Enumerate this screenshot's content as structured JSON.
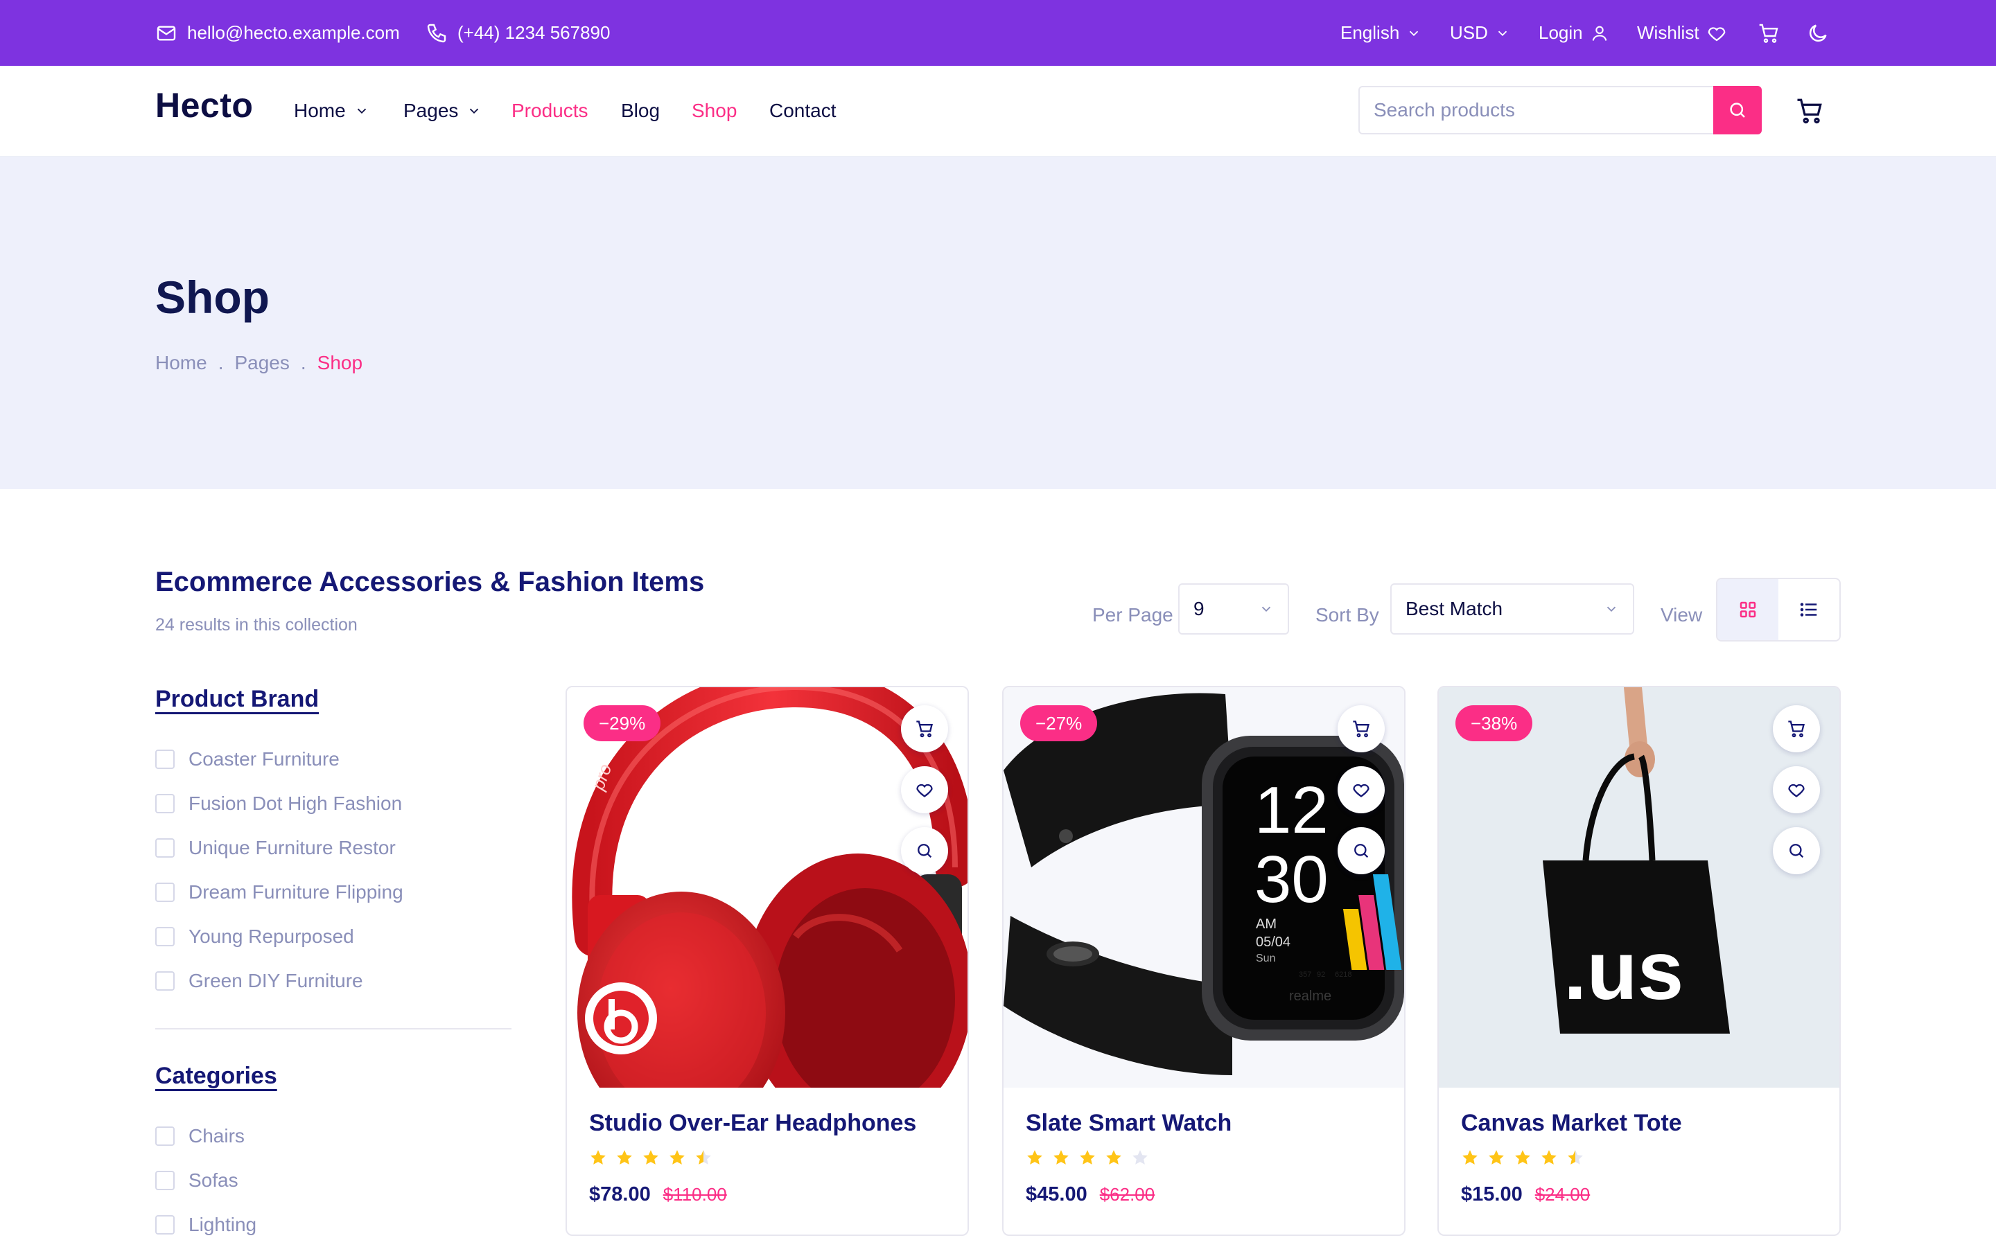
{
  "colors": {
    "topbar": "#7e33e0",
    "accent": "#fb2e86",
    "navy": "#151875",
    "muted": "#8a8fb9",
    "hero_bg": "#eef0fb",
    "star": "#ffc416"
  },
  "topbar": {
    "email": "hello@hecto.example.com",
    "phone": "(+44) 1234 567890",
    "language": "English",
    "currency": "USD",
    "login": "Login",
    "wishlist": "Wishlist",
    "icons": [
      "mail-icon",
      "phone-icon",
      "chevron-down-icon",
      "user-icon",
      "heart-icon",
      "cart-icon",
      "moon-icon"
    ]
  },
  "nav": {
    "logo": "Hecto",
    "links": {
      "home": "Home",
      "pages": "Pages",
      "products": "Products",
      "blog": "Blog",
      "shop": "Shop",
      "contact": "Contact"
    },
    "search_placeholder": "Search products"
  },
  "hero": {
    "title": "Shop",
    "breadcrumb": [
      "Home",
      "Pages",
      "Shop"
    ],
    "separator": "."
  },
  "collection": {
    "title": "Ecommerce Accessories & Fashion Items",
    "results": "24 results in this collection",
    "per_page_label": "Per Page",
    "per_page_value": "9",
    "sort_label": "Sort By",
    "sort_value": "Best Match",
    "view_label": "View",
    "view_mode": "grid"
  },
  "filters": {
    "brand_title": "Product Brand",
    "brands": [
      "Coaster Furniture",
      "Fusion Dot High Fashion",
      "Unique Furniture Restor",
      "Dream Furniture Flipping",
      "Young Repurposed",
      "Green DIY Furniture"
    ],
    "categories_title": "Categories",
    "categories": [
      "Chairs",
      "Sofas",
      "Lighting"
    ]
  },
  "products": [
    {
      "name": "Studio Over-Ear Headphones",
      "discount": "−29%",
      "price": "$78.00",
      "old_price": "$110.00",
      "rating": 4.5,
      "image": "red-headphones"
    },
    {
      "name": "Slate Smart Watch",
      "discount": "−27%",
      "price": "$45.00",
      "old_price": "$62.00",
      "rating": 4,
      "image": "black-smartwatch"
    },
    {
      "name": "Canvas Market Tote",
      "discount": "−38%",
      "price": "$15.00",
      "old_price": "$24.00",
      "rating": 4.5,
      "image": "black-tote-bag"
    }
  ],
  "product_art": {
    "headphones_logo": "pro",
    "watch_hour": "12",
    "watch_minute": "30",
    "watch_ampm": "AM",
    "watch_date": "05/04",
    "watch_day": "Sun",
    "watch_stats": [
      "357",
      "92",
      "6218"
    ],
    "watch_brand": "realme",
    "tote_print": ".us"
  }
}
